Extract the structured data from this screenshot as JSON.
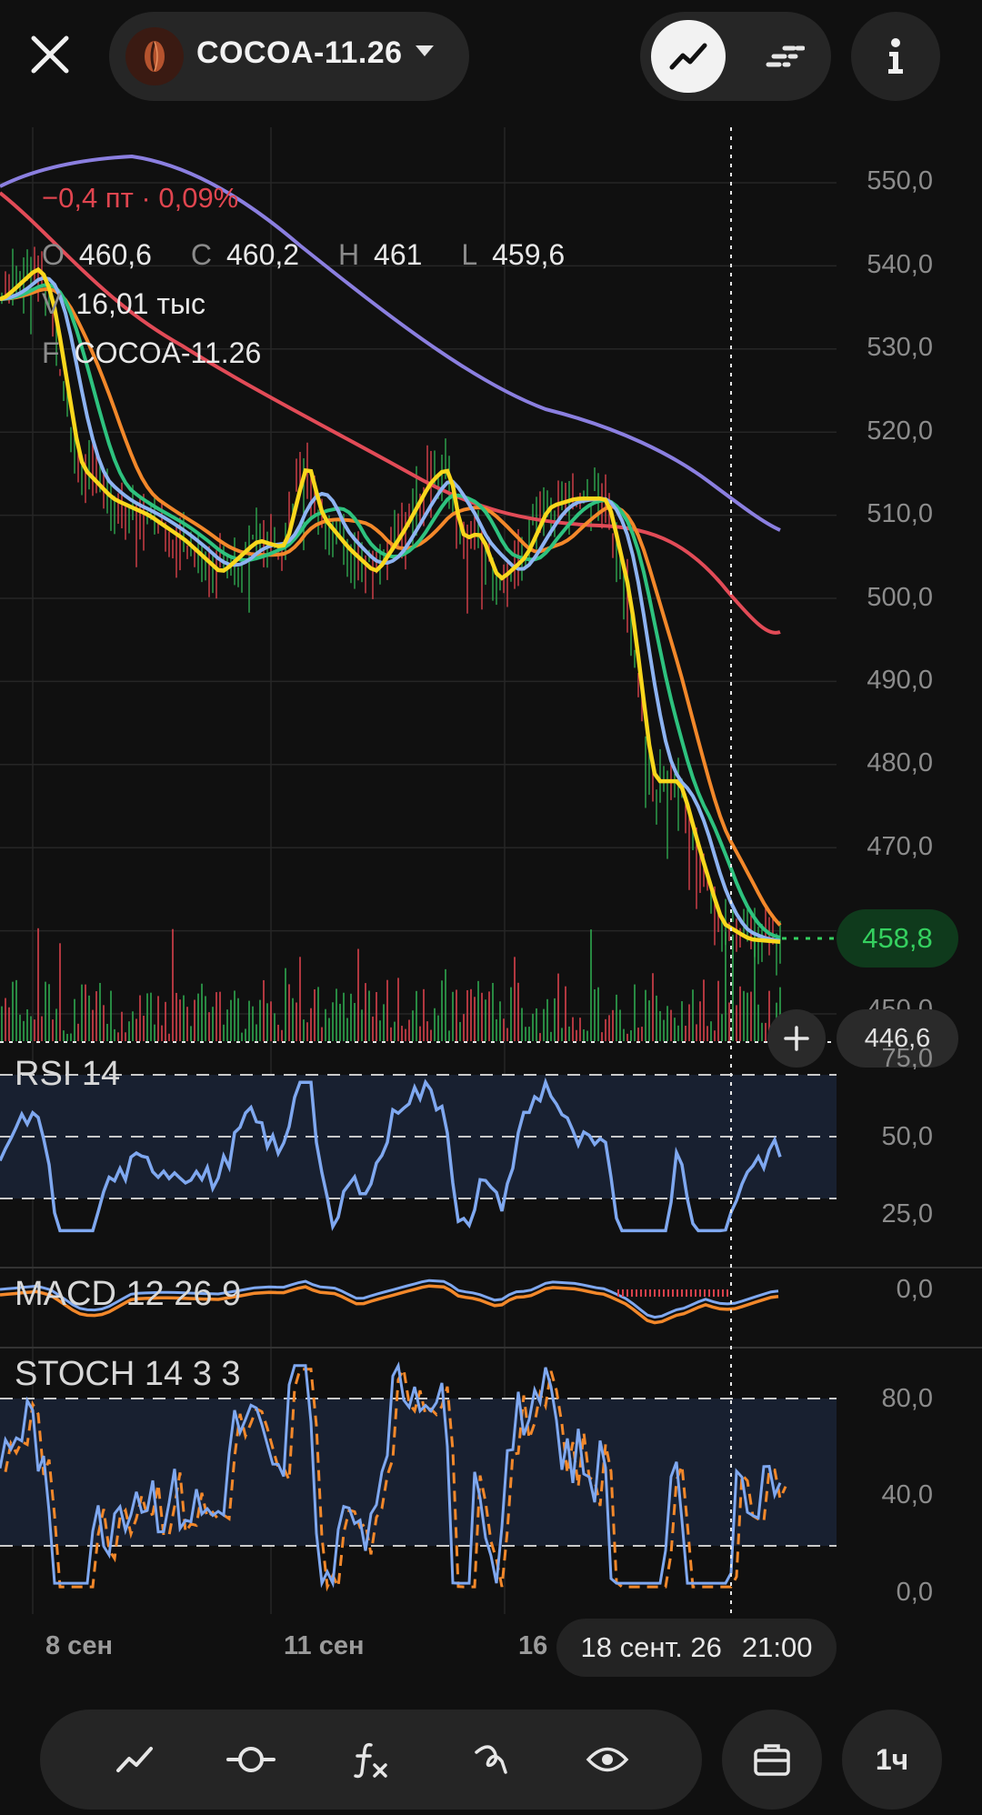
{
  "header": {
    "ticker": "COCOA-11.26",
    "icons": {
      "close": "close-icon",
      "logo": "cocoa-bean-icon",
      "dropdown": "caret-down-icon",
      "line_mode": "line-chart-icon",
      "bars_mode": "dashed-chart-icon",
      "info": "info-icon"
    }
  },
  "legend": {
    "change": "−0,4 пт · 0,09%",
    "open_key": "O",
    "open": "460,6",
    "close_key": "C",
    "close": "460,2",
    "high_key": "H",
    "high": "461",
    "low_key": "L",
    "low": "459,6",
    "volume_key": "V",
    "volume": "16,01 тыс",
    "future_key": "F",
    "future": "COCOA-11.26"
  },
  "price_axis": [
    "550,0",
    "540,0",
    "530,0",
    "520,0",
    "510,0",
    "500,0",
    "490,0",
    "480,0",
    "470,0",
    "450,0"
  ],
  "last_price": "458,8",
  "crosshair_price": "446,6",
  "rsi": {
    "label": "RSI 14",
    "axis": [
      "75,0",
      "50,0",
      "25,0"
    ]
  },
  "macd": {
    "label": "MACD 12 26 9",
    "axis": [
      "0,0"
    ]
  },
  "stoch": {
    "label": "STOCH 14 3 3",
    "axis": [
      "80,0",
      "40,0",
      "0,0"
    ]
  },
  "time_axis": [
    "8 сен",
    "11 сен",
    "16"
  ],
  "crosshair_date": "18 сент. 26",
  "crosshair_time": "21:00",
  "toolbar": {
    "icons": [
      "trend-line-icon",
      "crosshair-icon",
      "function-icon",
      "drawing-icon",
      "eye-icon"
    ],
    "portfolio_icon": "briefcase-icon",
    "interval": "1ч"
  },
  "colors": {
    "up": "#2fa84f",
    "down": "#d8414b",
    "ma_purple": "#8b7fe0",
    "ma_red": "#e24b57",
    "ma_orange": "#f3882a",
    "ma_green": "#2ec27e",
    "ma_blue": "#8db3f2",
    "ma_yellow": "#f9d71c",
    "last_price": "#35d05f"
  }
}
